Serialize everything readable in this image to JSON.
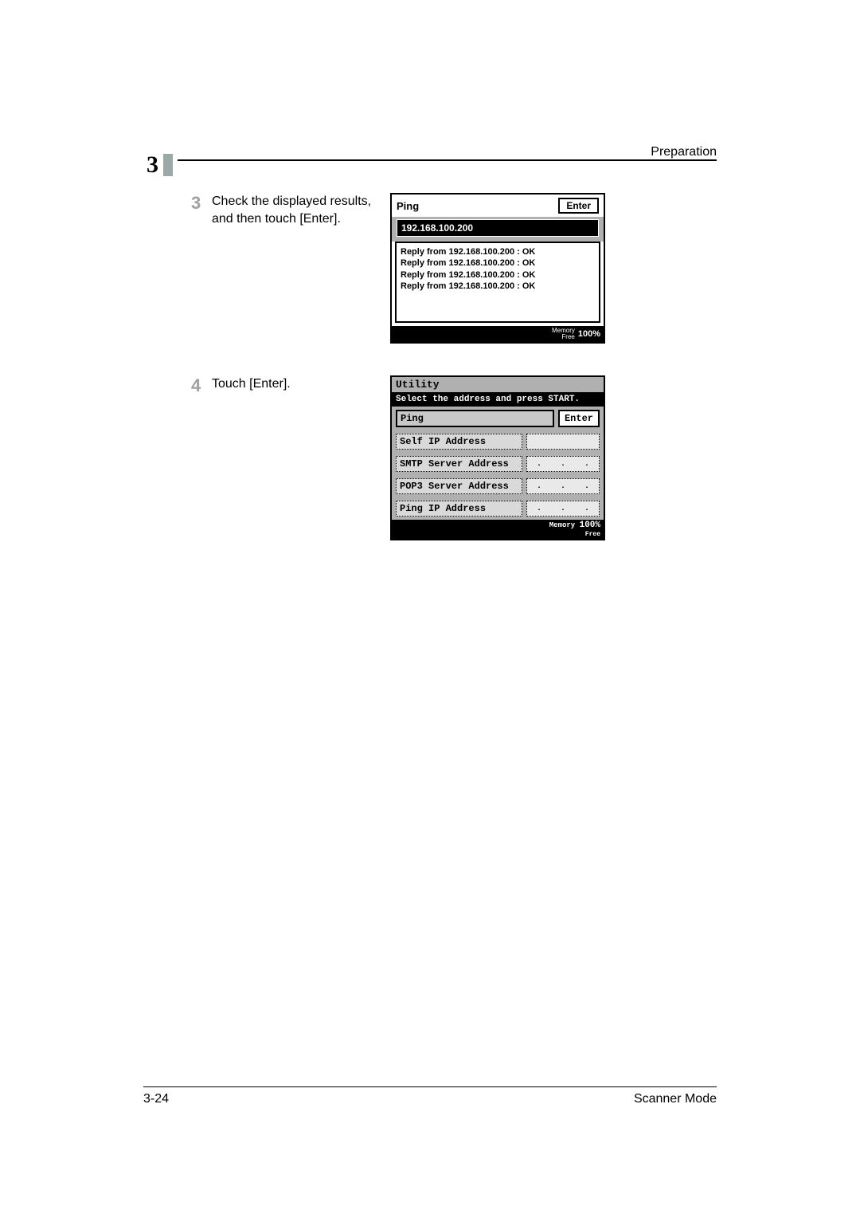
{
  "chapter_number": "3",
  "header_title": "Preparation",
  "steps": [
    {
      "number": "3",
      "text_line1": "Check the displayed results,",
      "text_line2": "and then touch [Enter]."
    },
    {
      "number": "4",
      "text_line1": "Touch [Enter].",
      "text_line2": ""
    }
  ],
  "screenA": {
    "title": "Ping",
    "enter": "Enter",
    "ip": "192.168.100.200",
    "replies": [
      "Reply from 192.168.100.200 : OK",
      "Reply from 192.168.100.200 : OK",
      "Reply from 192.168.100.200 : OK",
      "Reply from 192.168.100.200 : OK"
    ],
    "mem_label_line1": "Memory",
    "mem_label_line2": "Free",
    "mem_value": "100%"
  },
  "screenB": {
    "utility": "Utility",
    "message": "Select the address and press START.",
    "ping": "Ping",
    "enter": "Enter",
    "rows": [
      "Self IP Address",
      "SMTP Server Address",
      "POP3 Server Address",
      "Ping IP Address"
    ],
    "dot": ".",
    "mem_label": "Memory",
    "mem_free": "Free",
    "mem_value": "100%"
  },
  "footer": {
    "page": "3-24",
    "mode": "Scanner Mode"
  }
}
